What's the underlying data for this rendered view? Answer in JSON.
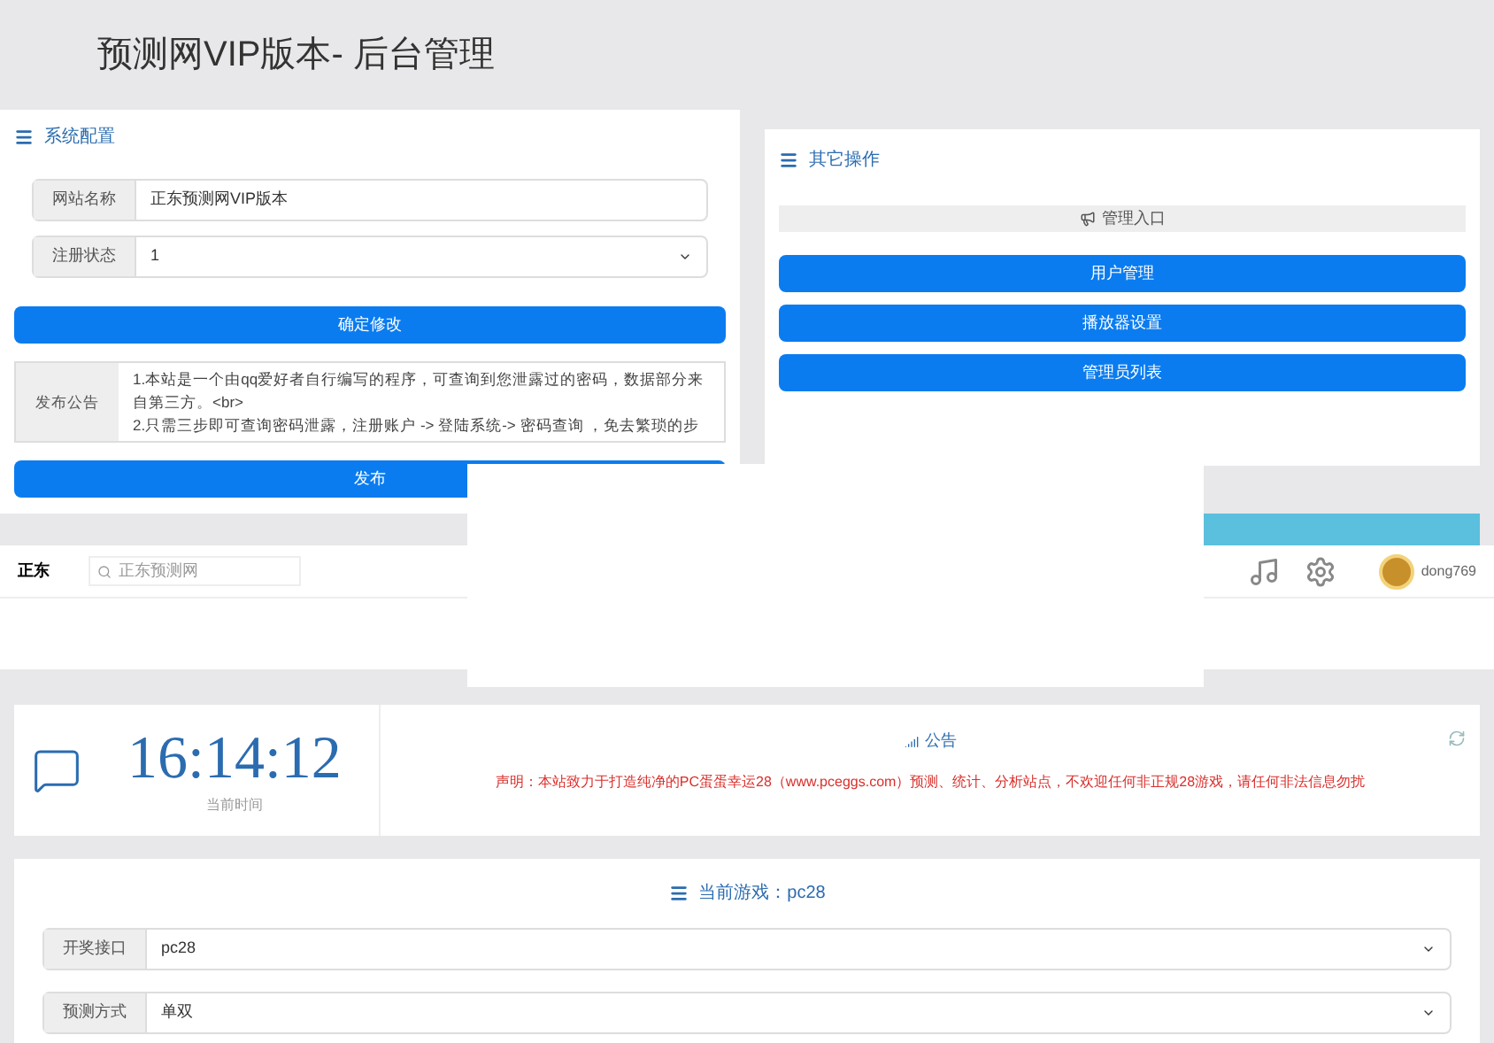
{
  "page_title": "预测网VIP版本- 后台管理",
  "system_config": {
    "title": "系统配置",
    "fields": [
      {
        "kind": "input",
        "label": "网站名称",
        "value": "正东预测网VIP版本"
      },
      {
        "kind": "select",
        "label": "注册状态",
        "value": "1"
      }
    ],
    "save_button": "确定修改",
    "notice_label": "发布公告",
    "notice_text": "1.本站是一个由qq爱好者自行编写的程序，可查询到您泄露过的密码，数据部分来自第三方。<br>\n2.只需三步即可查询密码泄露，注册账户 -> 登陆系统-> 密码查询 ，免去繁琐的步",
    "publish_button": "发布"
  },
  "other_ops": {
    "title": "其它操作",
    "section_label": "管理入口",
    "buttons": [
      "用户管理",
      "播放器设置",
      "管理员列表"
    ]
  },
  "navbar": {
    "brand": "正东",
    "search_placeholder": "正东预测网",
    "username": "dong769"
  },
  "clock": {
    "time": "16:14:12",
    "caption": "当前时间"
  },
  "announcement": {
    "title": "公告",
    "text": "声明：本站致力于打造纯净的PC蛋蛋幸运28（www.pceggs.com）预测、统计、分析站点，不欢迎任何非正规28游戏，请任何非法信息勿扰"
  },
  "game": {
    "title": "当前游戏：pc28",
    "fields": [
      {
        "label": "开奖接口",
        "value": "pc28"
      },
      {
        "label": "预测方式",
        "value": "单双"
      }
    ]
  }
}
